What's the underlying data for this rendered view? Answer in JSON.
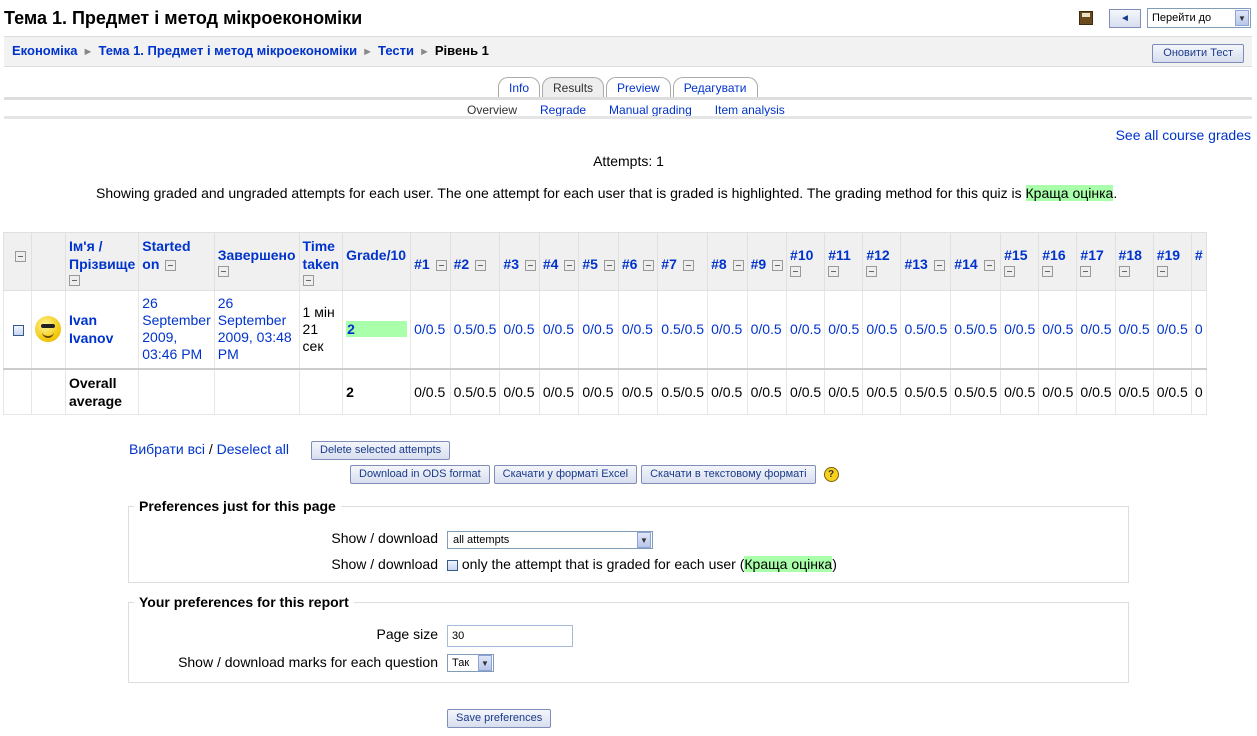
{
  "header": {
    "title": "Тема 1. Предмет і метод мікроекономіки",
    "jump_label": "Перейти до"
  },
  "breadcrumb": [
    "Економіка",
    "Тема 1. Предмет і метод мікроекономіки",
    "Тести",
    "Рівень 1"
  ],
  "update_button": "Оновити Тест",
  "tabs": [
    {
      "label": "Info",
      "active": false
    },
    {
      "label": "Results",
      "active": true
    },
    {
      "label": "Preview",
      "active": false
    },
    {
      "label": "Редагувати",
      "active": false
    }
  ],
  "subtabs": [
    {
      "label": "Overview",
      "active": true
    },
    {
      "label": "Regrade",
      "active": false
    },
    {
      "label": "Manual grading",
      "active": false
    },
    {
      "label": "Item analysis",
      "active": false
    }
  ],
  "see_all_grades": "See all course grades",
  "attempts_text": "Attempts: 1",
  "showing": {
    "text": "Showing graded and ungraded attempts for each user. The one attempt for each user that is graded is highlighted. The grading method for this quiz is ",
    "method": "Краща оцінка",
    "end": "."
  },
  "table": {
    "headers": {
      "name": "Ім'я / Прізвище",
      "started": "Started on",
      "completed": "Завершено",
      "time": "Time taken",
      "grade": "Grade/10"
    },
    "questions": [
      "#1",
      "#2",
      "#3",
      "#4",
      "#5",
      "#6",
      "#7",
      "#8",
      "#9",
      "#10",
      "#11",
      "#12",
      "#13",
      "#14",
      "#15",
      "#16",
      "#17",
      "#18",
      "#19",
      "#"
    ],
    "row": {
      "name": "Ivan Ivanov",
      "started": "26 September 2009, 03:46 PM",
      "completed": "26 September 2009, 03:48 PM",
      "time": "1 мін 21 сек",
      "grade": "2",
      "scores": [
        "0/0.5",
        "0.5/0.5",
        "0/0.5",
        "0/0.5",
        "0/0.5",
        "0/0.5",
        "0.5/0.5",
        "0/0.5",
        "0/0.5",
        "0/0.5",
        "0/0.5",
        "0/0.5",
        "0.5/0.5",
        "0.5/0.5",
        "0/0.5",
        "0/0.5",
        "0/0.5",
        "0/0.5",
        "0/0.5",
        "0"
      ]
    },
    "average": {
      "label": "Overall average",
      "grade": "2",
      "scores": [
        "0/0.5",
        "0.5/0.5",
        "0/0.5",
        "0/0.5",
        "0/0.5",
        "0/0.5",
        "0.5/0.5",
        "0/0.5",
        "0/0.5",
        "0/0.5",
        "0/0.5",
        "0/0.5",
        "0.5/0.5",
        "0.5/0.5",
        "0/0.5",
        "0/0.5",
        "0/0.5",
        "0/0.5",
        "0/0.5",
        "0"
      ]
    }
  },
  "select_all": "Вибрати всі",
  "slash": " / ",
  "deselect_all": "Deselect all",
  "delete_button": "Delete selected attempts",
  "download_buttons": [
    "Download in ODS format",
    "Скачати у форматі Excel",
    "Скачати в текстовому форматі"
  ],
  "prefs_page": {
    "legend": "Preferences just for this page",
    "show_label": "Show / download",
    "show_value": "all attempts",
    "show2_label": "Show / download",
    "only_graded_text": "only the attempt that is graded for each user (",
    "only_graded_method": "Краща оцінка",
    "only_graded_end": ")"
  },
  "prefs_report": {
    "legend": "Your preferences for this report",
    "page_size_label": "Page size",
    "page_size_value": "30",
    "marks_label": "Show / download marks for each question",
    "marks_value": "Так"
  },
  "save_button": "Save preferences",
  "colors": {
    "highlight": "#aaffaa",
    "link": "#0033cc"
  }
}
